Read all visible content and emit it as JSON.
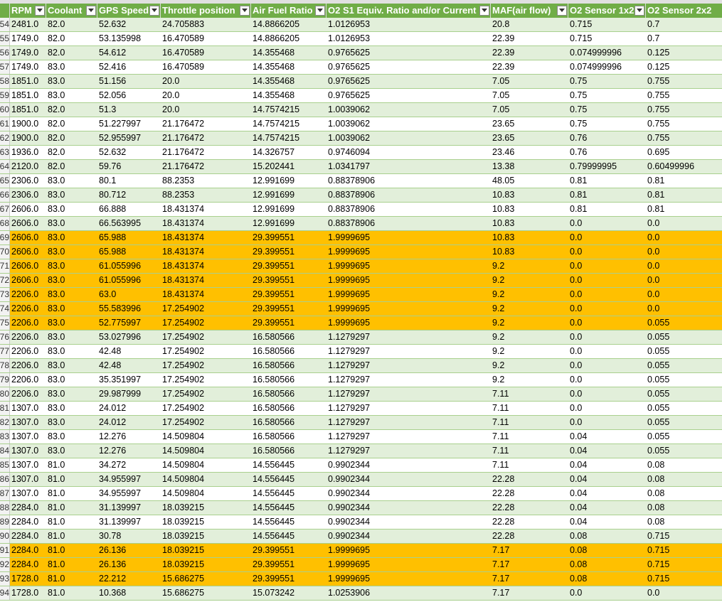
{
  "columns": [
    "RPM",
    "Coolant",
    "GPS Speed",
    "Throttle position",
    "Air Fuel Ratio",
    "O2 S1 Equiv. Ratio and/or Current",
    "MAF(air flow)",
    "O2 Sensor 1x2",
    "O2 Sensor 2x2"
  ],
  "colors": {
    "header": "#70ad47",
    "band": "#e2efda",
    "highlight": "#ffc000"
  },
  "rows": [
    {
      "n": "54",
      "style": "band",
      "c": [
        "2481.0",
        "82.0",
        "52.632",
        "24.705883",
        "14.8866205",
        "1.0126953",
        "20.8",
        "0.715",
        "0.7"
      ]
    },
    {
      "n": "55",
      "style": "plain",
      "c": [
        "1749.0",
        "82.0",
        "53.135998",
        "16.470589",
        "14.8866205",
        "1.0126953",
        "22.39",
        "0.715",
        "0.7"
      ]
    },
    {
      "n": "56",
      "style": "band",
      "c": [
        "1749.0",
        "82.0",
        "54.612",
        "16.470589",
        "14.355468",
        "0.9765625",
        "22.39",
        "0.074999996",
        "0.125"
      ]
    },
    {
      "n": "57",
      "style": "plain",
      "c": [
        "1749.0",
        "83.0",
        "52.416",
        "16.470589",
        "14.355468",
        "0.9765625",
        "22.39",
        "0.074999996",
        "0.125"
      ]
    },
    {
      "n": "58",
      "style": "band",
      "c": [
        "1851.0",
        "83.0",
        "51.156",
        "20.0",
        "14.355468",
        "0.9765625",
        "7.05",
        "0.75",
        "0.755"
      ]
    },
    {
      "n": "59",
      "style": "plain",
      "c": [
        "1851.0",
        "83.0",
        "52.056",
        "20.0",
        "14.355468",
        "0.9765625",
        "7.05",
        "0.75",
        "0.755"
      ]
    },
    {
      "n": "60",
      "style": "band",
      "c": [
        "1851.0",
        "82.0",
        "51.3",
        "20.0",
        "14.7574215",
        "1.0039062",
        "7.05",
        "0.75",
        "0.755"
      ]
    },
    {
      "n": "61",
      "style": "plain",
      "c": [
        "1900.0",
        "82.0",
        "51.227997",
        "21.176472",
        "14.7574215",
        "1.0039062",
        "23.65",
        "0.75",
        "0.755"
      ]
    },
    {
      "n": "62",
      "style": "band",
      "c": [
        "1900.0",
        "82.0",
        "52.955997",
        "21.176472",
        "14.7574215",
        "1.0039062",
        "23.65",
        "0.76",
        "0.755"
      ]
    },
    {
      "n": "63",
      "style": "plain",
      "c": [
        "1936.0",
        "82.0",
        "52.632",
        "21.176472",
        "14.326757",
        "0.9746094",
        "23.46",
        "0.76",
        "0.695"
      ]
    },
    {
      "n": "64",
      "style": "band",
      "c": [
        "2120.0",
        "82.0",
        "59.76",
        "21.176472",
        "15.202441",
        "1.0341797",
        "13.38",
        "0.79999995",
        "0.60499996"
      ]
    },
    {
      "n": "65",
      "style": "plain",
      "c": [
        "2306.0",
        "83.0",
        "80.1",
        "88.2353",
        "12.991699",
        "0.88378906",
        "48.05",
        "0.81",
        "0.81"
      ]
    },
    {
      "n": "66",
      "style": "band",
      "c": [
        "2306.0",
        "83.0",
        "80.712",
        "88.2353",
        "12.991699",
        "0.88378906",
        "10.83",
        "0.81",
        "0.81"
      ]
    },
    {
      "n": "67",
      "style": "plain",
      "c": [
        "2606.0",
        "83.0",
        "66.888",
        "18.431374",
        "12.991699",
        "0.88378906",
        "10.83",
        "0.81",
        "0.81"
      ]
    },
    {
      "n": "68",
      "style": "band",
      "c": [
        "2606.0",
        "83.0",
        "66.563995",
        "18.431374",
        "12.991699",
        "0.88378906",
        "10.83",
        "0.0",
        "0.0"
      ]
    },
    {
      "n": "69",
      "style": "hl",
      "c": [
        "2606.0",
        "83.0",
        "65.988",
        "18.431374",
        "29.399551",
        "1.9999695",
        "10.83",
        "0.0",
        "0.0"
      ]
    },
    {
      "n": "70",
      "style": "hl",
      "c": [
        "2606.0",
        "83.0",
        "65.988",
        "18.431374",
        "29.399551",
        "1.9999695",
        "10.83",
        "0.0",
        "0.0"
      ]
    },
    {
      "n": "71",
      "style": "hl",
      "c": [
        "2606.0",
        "83.0",
        "61.055996",
        "18.431374",
        "29.399551",
        "1.9999695",
        "9.2",
        "0.0",
        "0.0"
      ]
    },
    {
      "n": "72",
      "style": "hl",
      "c": [
        "2606.0",
        "83.0",
        "61.055996",
        "18.431374",
        "29.399551",
        "1.9999695",
        "9.2",
        "0.0",
        "0.0"
      ]
    },
    {
      "n": "73",
      "style": "hl",
      "c": [
        "2206.0",
        "83.0",
        "63.0",
        "18.431374",
        "29.399551",
        "1.9999695",
        "9.2",
        "0.0",
        "0.0"
      ]
    },
    {
      "n": "74",
      "style": "hl",
      "c": [
        "2206.0",
        "83.0",
        "55.583996",
        "17.254902",
        "29.399551",
        "1.9999695",
        "9.2",
        "0.0",
        "0.0"
      ]
    },
    {
      "n": "75",
      "style": "hl",
      "c": [
        "2206.0",
        "83.0",
        "52.775997",
        "17.254902",
        "29.399551",
        "1.9999695",
        "9.2",
        "0.0",
        "0.055"
      ]
    },
    {
      "n": "76",
      "style": "band",
      "c": [
        "2206.0",
        "83.0",
        "53.027996",
        "17.254902",
        "16.580566",
        "1.1279297",
        "9.2",
        "0.0",
        "0.055"
      ]
    },
    {
      "n": "77",
      "style": "plain",
      "c": [
        "2206.0",
        "83.0",
        "42.48",
        "17.254902",
        "16.580566",
        "1.1279297",
        "9.2",
        "0.0",
        "0.055"
      ]
    },
    {
      "n": "78",
      "style": "band",
      "c": [
        "2206.0",
        "83.0",
        "42.48",
        "17.254902",
        "16.580566",
        "1.1279297",
        "9.2",
        "0.0",
        "0.055"
      ]
    },
    {
      "n": "79",
      "style": "plain",
      "c": [
        "2206.0",
        "83.0",
        "35.351997",
        "17.254902",
        "16.580566",
        "1.1279297",
        "9.2",
        "0.0",
        "0.055"
      ]
    },
    {
      "n": "80",
      "style": "band",
      "c": [
        "2206.0",
        "83.0",
        "29.987999",
        "17.254902",
        "16.580566",
        "1.1279297",
        "7.11",
        "0.0",
        "0.055"
      ]
    },
    {
      "n": "81",
      "style": "plain",
      "c": [
        "1307.0",
        "83.0",
        "24.012",
        "17.254902",
        "16.580566",
        "1.1279297",
        "7.11",
        "0.0",
        "0.055"
      ]
    },
    {
      "n": "82",
      "style": "band",
      "c": [
        "1307.0",
        "83.0",
        "24.012",
        "17.254902",
        "16.580566",
        "1.1279297",
        "7.11",
        "0.0",
        "0.055"
      ]
    },
    {
      "n": "83",
      "style": "plain",
      "c": [
        "1307.0",
        "83.0",
        "12.276",
        "14.509804",
        "16.580566",
        "1.1279297",
        "7.11",
        "0.04",
        "0.055"
      ]
    },
    {
      "n": "84",
      "style": "band",
      "c": [
        "1307.0",
        "83.0",
        "12.276",
        "14.509804",
        "16.580566",
        "1.1279297",
        "7.11",
        "0.04",
        "0.055"
      ]
    },
    {
      "n": "85",
      "style": "plain",
      "c": [
        "1307.0",
        "81.0",
        "34.272",
        "14.509804",
        "14.556445",
        "0.9902344",
        "7.11",
        "0.04",
        "0.08"
      ]
    },
    {
      "n": "86",
      "style": "band",
      "c": [
        "1307.0",
        "81.0",
        "34.955997",
        "14.509804",
        "14.556445",
        "0.9902344",
        "22.28",
        "0.04",
        "0.08"
      ]
    },
    {
      "n": "87",
      "style": "plain",
      "c": [
        "1307.0",
        "81.0",
        "34.955997",
        "14.509804",
        "14.556445",
        "0.9902344",
        "22.28",
        "0.04",
        "0.08"
      ]
    },
    {
      "n": "88",
      "style": "band",
      "c": [
        "2284.0",
        "81.0",
        "31.139997",
        "18.039215",
        "14.556445",
        "0.9902344",
        "22.28",
        "0.04",
        "0.08"
      ]
    },
    {
      "n": "89",
      "style": "plain",
      "c": [
        "2284.0",
        "81.0",
        "31.139997",
        "18.039215",
        "14.556445",
        "0.9902344",
        "22.28",
        "0.04",
        "0.08"
      ]
    },
    {
      "n": "90",
      "style": "band",
      "c": [
        "2284.0",
        "81.0",
        "30.78",
        "18.039215",
        "14.556445",
        "0.9902344",
        "22.28",
        "0.08",
        "0.715"
      ]
    },
    {
      "n": "91",
      "style": "hl",
      "c": [
        "2284.0",
        "81.0",
        "26.136",
        "18.039215",
        "29.399551",
        "1.9999695",
        "7.17",
        "0.08",
        "0.715"
      ]
    },
    {
      "n": "92",
      "style": "hl",
      "c": [
        "2284.0",
        "81.0",
        "26.136",
        "18.039215",
        "29.399551",
        "1.9999695",
        "7.17",
        "0.08",
        "0.715"
      ]
    },
    {
      "n": "93",
      "style": "hl",
      "c": [
        "1728.0",
        "81.0",
        "22.212",
        "15.686275",
        "29.399551",
        "1.9999695",
        "7.17",
        "0.08",
        "0.715"
      ]
    },
    {
      "n": "94",
      "style": "band",
      "c": [
        "1728.0",
        "81.0",
        "10.368",
        "15.686275",
        "15.073242",
        "1.0253906",
        "7.17",
        "0.0",
        "0.0"
      ]
    }
  ]
}
